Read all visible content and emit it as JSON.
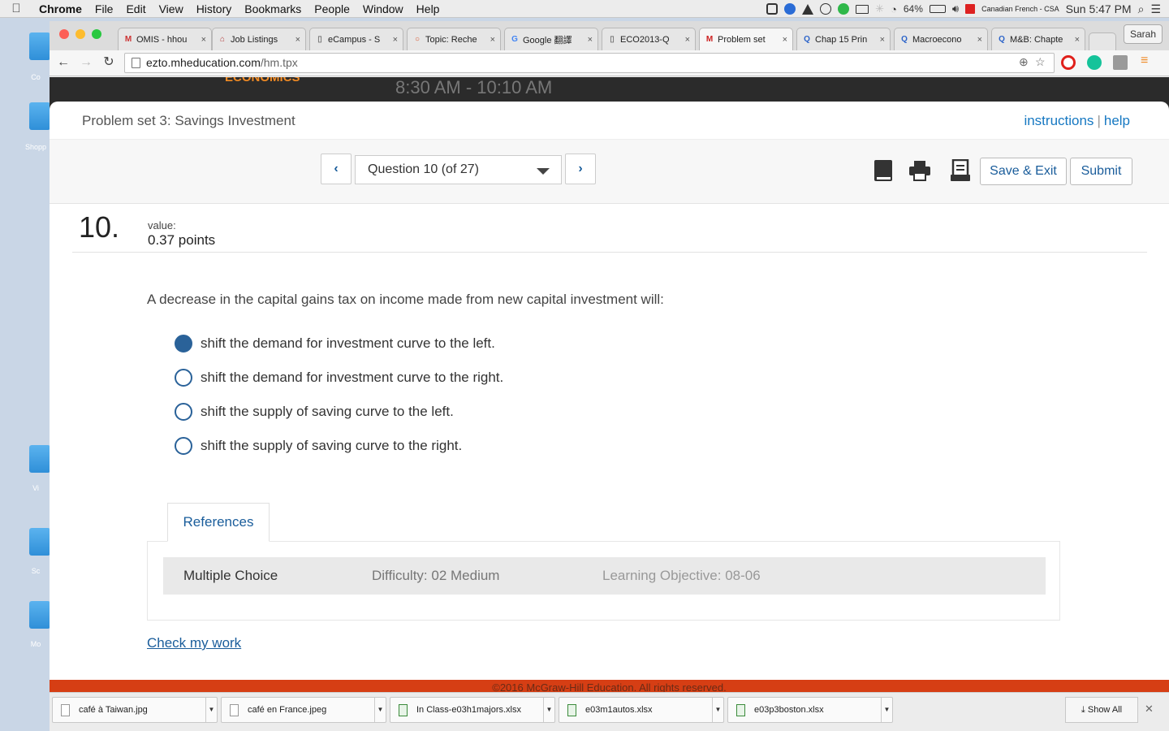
{
  "menubar": {
    "app": "Chrome",
    "items": [
      "File",
      "Edit",
      "View",
      "History",
      "Bookmarks",
      "People",
      "Window",
      "Help"
    ],
    "battery": "64%",
    "input_source": "Canadian French - CSA",
    "clock": "Sun 5:47 PM"
  },
  "desktop": {
    "labels": [
      "Co",
      "Shopp",
      "Vi",
      "Sc",
      "Mo"
    ]
  },
  "browser": {
    "tabs": [
      {
        "label": "OMIS - hhou",
        "icon": "m-icon",
        "color": "#cc3333"
      },
      {
        "label": "Job Listings",
        "icon": "house-icon",
        "color": "#b23b3b"
      },
      {
        "label": "eCampus - S",
        "icon": "page-icon",
        "color": "#777777"
      },
      {
        "label": "Topic: Reche",
        "icon": "ring-icon",
        "color": "#d9532c"
      },
      {
        "label": "Google 翻譯",
        "icon": "translate-icon",
        "color": "#4285f4"
      },
      {
        "label": "ECO2013-Q",
        "icon": "page-icon",
        "color": "#777777"
      },
      {
        "label": "Problem set",
        "icon": "m-icon",
        "color": "#cc1f1f"
      },
      {
        "label": "Chap 15 Prin",
        "icon": "q-icon",
        "color": "#2b63c9"
      },
      {
        "label": "Macroecono",
        "icon": "q-icon",
        "color": "#2b63c9"
      },
      {
        "label": "M&B: Chapte",
        "icon": "q-icon",
        "color": "#2b63c9"
      }
    ],
    "active_tab": 6,
    "profile": "Sarah",
    "url_host": "ezto.mheducation.com",
    "url_path": "/hm.tpx"
  },
  "page": {
    "banner_brand": "ECONOMICS",
    "banner_time": "8:30 AM - 10:10 AM",
    "problem_title": "Problem set 3: Savings Investment",
    "instructions_link": "instructions",
    "help_link": "help",
    "link_separator": "|",
    "question_select": "Question 10 (of 27)",
    "save_exit": "Save & Exit",
    "submit": "Submit",
    "question_number": "10.",
    "value_label": "value:",
    "value_points": "0.37 points",
    "question_text": "A decrease in the capital gains tax on income made from new capital investment will:",
    "options": [
      {
        "label": "shift the demand for investment curve to the left.",
        "checked": true
      },
      {
        "label": "shift the demand for investment curve to the right.",
        "checked": false
      },
      {
        "label": "shift the supply of saving curve to the left.",
        "checked": false
      },
      {
        "label": "shift the supply of saving curve to the right.",
        "checked": false
      }
    ],
    "references_tab": "References",
    "ref_type": "Multiple Choice",
    "ref_difficulty": "Difficulty: 02 Medium",
    "ref_objective": "Learning Objective: 08-06",
    "check_work": "Check my work",
    "footer": "©2016 McGraw-Hill Education. All rights reserved.",
    "colors": {
      "accent": "#1a5d9b",
      "link": "#1678c2",
      "footer": "#d63e14",
      "radio": "#2a6299"
    }
  },
  "downloads": {
    "items": [
      {
        "name": "café à Taiwan.jpg",
        "type": "image"
      },
      {
        "name": "café en France.jpeg",
        "type": "image"
      },
      {
        "name": "In Class-e03h1majors.xlsx",
        "type": "excel"
      },
      {
        "name": "e03m1autos.xlsx",
        "type": "excel"
      },
      {
        "name": "e03p3boston.xlsx",
        "type": "excel"
      }
    ],
    "show_all": "Show All"
  }
}
